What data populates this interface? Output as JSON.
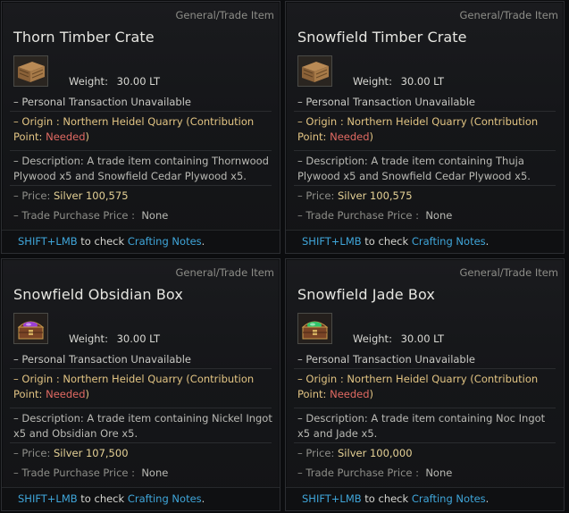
{
  "tooltips": [
    {
      "category": "General/Trade Item",
      "name": "Thorn Timber Crate",
      "icon": "wooden-crate-icon",
      "weight_label": "Weight:",
      "weight_value": "30.00 LT",
      "transaction": "– Personal Transaction Unavailable",
      "origin_prefix": "– Origin : Northern Heidel Quarry (Contribution Point: ",
      "origin_needed": "Needed",
      "origin_suffix": ")",
      "description": "– Description: A trade item containing Thornwood Plywood x5 and Snowfield Cedar Plywood x5.",
      "price_label": "– Price:",
      "price_value": "Silver 100,575",
      "trade_price_label": "– Trade Purchase Price :",
      "trade_price_value": "None",
      "footer_key": "SHIFT+LMB",
      "footer_mid": " to check ",
      "footer_link": "Crafting Notes",
      "footer_end": "."
    },
    {
      "category": "General/Trade Item",
      "name": "Snowfield Timber Crate",
      "icon": "wooden-crate-icon",
      "weight_label": "Weight:",
      "weight_value": "30.00 LT",
      "transaction": "– Personal Transaction Unavailable",
      "origin_prefix": "– Origin : Northern Heidel Quarry (Contribution Point: ",
      "origin_needed": "Needed",
      "origin_suffix": ")",
      "description": "– Description: A trade item containing Thuja Plywood x5 and Snowfield Cedar Plywood x5.",
      "price_label": "– Price:",
      "price_value": "Silver 100,575",
      "trade_price_label": "– Trade Purchase Price :",
      "trade_price_value": "None",
      "footer_key": "SHIFT+LMB",
      "footer_mid": " to check ",
      "footer_link": "Crafting Notes",
      "footer_end": "."
    },
    {
      "category": "General/Trade Item",
      "name": "Snowfield Obsidian Box",
      "icon": "purple-gem-chest-icon",
      "weight_label": "Weight:",
      "weight_value": "30.00 LT",
      "transaction": "– Personal Transaction Unavailable",
      "origin_prefix": "– Origin : Northern Heidel Quarry (Contribution Point: ",
      "origin_needed": "Needed",
      "origin_suffix": ")",
      "description": "– Description: A trade item containing Nickel Ingot x5 and Obsidian Ore x5.",
      "price_label": "– Price:",
      "price_value": "Silver 107,500",
      "trade_price_label": "– Trade Purchase Price :",
      "trade_price_value": "None",
      "footer_key": "SHIFT+LMB",
      "footer_mid": " to check ",
      "footer_link": "Crafting Notes",
      "footer_end": "."
    },
    {
      "category": "General/Trade Item",
      "name": "Snowfield Jade Box",
      "icon": "green-gem-chest-icon",
      "weight_label": "Weight:",
      "weight_value": "30.00 LT",
      "transaction": "– Personal Transaction Unavailable",
      "origin_prefix": "– Origin : Northern Heidel Quarry (Contribution Point: ",
      "origin_needed": "Needed",
      "origin_suffix": ")",
      "description": "– Description: A trade item containing Noc Ingot x5 and Jade x5.",
      "price_label": "– Price:",
      "price_value": "Silver 100,000",
      "trade_price_label": "– Trade Purchase Price :",
      "trade_price_value": "None",
      "footer_key": "SHIFT+LMB",
      "footer_mid": " to check ",
      "footer_link": "Crafting Notes",
      "footer_end": "."
    }
  ],
  "colors": {
    "origin_text": "#e2c483",
    "needed": "#e16a62",
    "price_value": "#e6d296",
    "link": "#3fa6da",
    "gem_purple": "#9a3fd6",
    "gem_green": "#2fc46a"
  }
}
